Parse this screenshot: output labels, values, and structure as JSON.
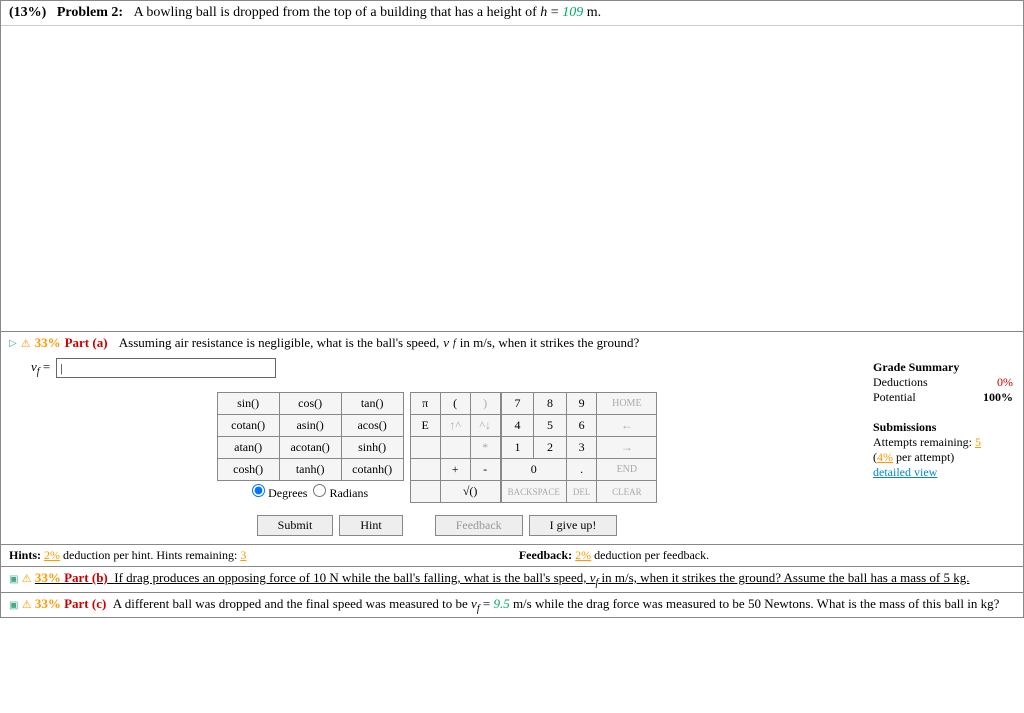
{
  "header": {
    "percent": "(13%)",
    "label": "Problem 2:",
    "text_before": "A bowling ball is dropped from the top of a building that has a height of ",
    "var": "h",
    "eq": " = ",
    "val": "109",
    "unit": " m."
  },
  "part_a": {
    "percent": "33%",
    "label": "Part (a)",
    "text_before": "Assuming air resistance is negligible, what is the ball's speed, ",
    "var": "v",
    "sub": "f",
    "text_after": " in m/s, when it strikes the ground?",
    "lhs_var": "v",
    "lhs_sub": "f",
    "lhs_eq": " = ",
    "input_value": "|"
  },
  "funcs": {
    "r1": [
      "sin()",
      "cos()",
      "tan()"
    ],
    "r2": [
      "cotan()",
      "asin()",
      "acos()"
    ],
    "r3": [
      "atan()",
      "acotan()",
      "sinh()"
    ],
    "r4": [
      "cosh()",
      "tanh()",
      "cotanh()"
    ],
    "deg": "Degrees",
    "rad": "Radians"
  },
  "sym": {
    "r1": [
      "π",
      "(",
      ")"
    ],
    "r2": [
      "E",
      "↑^",
      "^↓"
    ],
    "r3": [
      "",
      "",
      "*"
    ],
    "r4": [
      "",
      "+",
      "-"
    ],
    "r5": [
      "",
      "√()"
    ]
  },
  "nums": {
    "r1": [
      "7",
      "8",
      "9",
      "HOME"
    ],
    "r2": [
      "4",
      "5",
      "6",
      "←"
    ],
    "r3": [
      "1",
      "2",
      "3",
      "→"
    ],
    "r4": [
      "0",
      ".",
      "END"
    ],
    "r5": [
      "BACKSPACE",
      "DEL",
      "CLEAR"
    ]
  },
  "buttons": {
    "submit": "Submit",
    "hint": "Hint",
    "feedback": "Feedback",
    "giveup": "I give up!"
  },
  "grade": {
    "title": "Grade Summary",
    "ded_label": "Deductions",
    "ded_val": "0%",
    "pot_label": "Potential",
    "pot_val": "100%",
    "sub_title": "Submissions",
    "attempts_label": "Attempts remaining: ",
    "attempts_val": "5",
    "per_attempt_pre": "(",
    "per_attempt_val": "4%",
    "per_attempt_post": " per attempt)",
    "detailed": "detailed view"
  },
  "hints": {
    "hints_label": "Hints: ",
    "hints_val": "2%",
    "hints_text": " deduction per hint. Hints remaining: ",
    "hints_rem": "3",
    "fb_label": "Feedback: ",
    "fb_val": "2%",
    "fb_text": " deduction per feedback."
  },
  "part_b": {
    "percent": "33%",
    "label": "Part (b)",
    "text": "If drag produces an opposing force of 10 N while the ball's falling, what is the ball's speed, ",
    "var": "v",
    "sub": "f",
    "text2": " in m/s, when it strikes the ground? Assume the ball has a mass of 5 kg."
  },
  "part_c": {
    "percent": "33%",
    "label": "Part (c)",
    "text_before": "A different ball was dropped and the final speed was measured to be ",
    "var": "v",
    "sub": "f",
    "eq": " = ",
    "val": "9.5",
    "text_mid": " m/s while the drag force was measured to be 50 Newtons. What is the mass of this ball in kg?"
  }
}
